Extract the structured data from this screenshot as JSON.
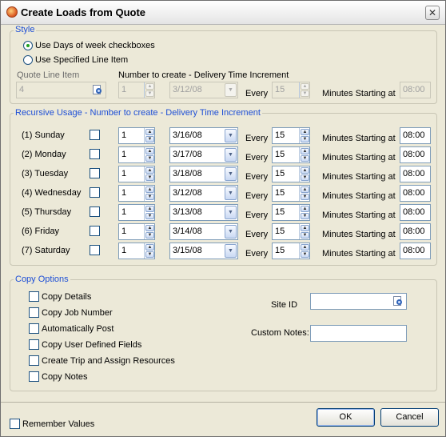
{
  "window": {
    "title": "Create Loads from Quote",
    "close_glyph": "✕",
    "title_icon": "app-icon"
  },
  "style": {
    "legend": "Style",
    "radio_days": {
      "label": "Use Days of week checkboxes",
      "checked": true
    },
    "radio_line": {
      "label": "Use Specified Line Item",
      "checked": false
    },
    "quote_line_item_label": "Quote Line Item",
    "quote_line_item_value": "4",
    "number_to_create_label": "Number to create - Delivery Time Increment",
    "number_value": "1",
    "date_value": "3/12/08",
    "every_label": "Every",
    "every_value": "15",
    "minutes_label": "Minutes Starting at",
    "start_value": "08:00"
  },
  "recursive": {
    "legend": "Recursive Usage - Number to create - Delivery Time Increment",
    "every_label": "Every",
    "minutes_label": "Minutes Starting at",
    "days": [
      {
        "label": "(1) Sunday",
        "checked": false,
        "count": "1",
        "date": "3/16/08",
        "every": "15",
        "start": "08:00"
      },
      {
        "label": "(2) Monday",
        "checked": false,
        "count": "1",
        "date": "3/17/08",
        "every": "15",
        "start": "08:00"
      },
      {
        "label": "(3) Tuesday",
        "checked": false,
        "count": "1",
        "date": "3/18/08",
        "every": "15",
        "start": "08:00"
      },
      {
        "label": "(4) Wednesday",
        "checked": false,
        "count": "1",
        "date": "3/12/08",
        "every": "15",
        "start": "08:00"
      },
      {
        "label": "(5) Thursday",
        "checked": false,
        "count": "1",
        "date": "3/13/08",
        "every": "15",
        "start": "08:00"
      },
      {
        "label": "(6) Friday",
        "checked": false,
        "count": "1",
        "date": "3/14/08",
        "every": "15",
        "start": "08:00"
      },
      {
        "label": "(7) Saturday",
        "checked": false,
        "count": "1",
        "date": "3/15/08",
        "every": "15",
        "start": "08:00"
      }
    ]
  },
  "copy": {
    "legend": "Copy Options",
    "options": [
      {
        "label": "Copy Details",
        "checked": false
      },
      {
        "label": "Copy Job Number",
        "checked": false
      },
      {
        "label": "Automatically Post",
        "checked": false
      },
      {
        "label": "Copy User Defined Fields",
        "checked": false
      },
      {
        "label": "Create Trip and Assign Resources",
        "checked": false
      },
      {
        "label": "Copy Notes",
        "checked": false
      }
    ],
    "site_id_label": "Site ID",
    "site_id_value": "",
    "custom_notes_label": "Custom Notes:",
    "custom_notes_value": ""
  },
  "footer": {
    "remember_label": "Remember Values",
    "remember_checked": false,
    "ok_label": "OK",
    "cancel_label": "Cancel"
  },
  "colors": {
    "legend_text": "#1e4fd6",
    "window_bg": "#ece9d8",
    "radio_dot": "#21a121"
  }
}
